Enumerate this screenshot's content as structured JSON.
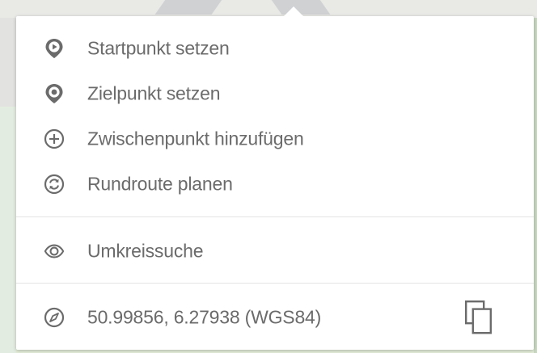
{
  "menu": {
    "items": [
      {
        "label": "Startpunkt setzen",
        "icon": "start-pin-icon"
      },
      {
        "label": "Zielpunkt setzen",
        "icon": "destination-pin-icon"
      },
      {
        "label": "Zwischenpunkt hinzufügen",
        "icon": "plus-circle-icon"
      },
      {
        "label": "Rundroute planen",
        "icon": "roundtrip-icon"
      }
    ],
    "search": {
      "label": "Umkreissuche",
      "icon": "eye-icon"
    },
    "coordinates": {
      "label": "50.99856, 6.27938 (WGS84)",
      "icon": "compass-icon",
      "copy_icon": "copy-icon"
    }
  },
  "colors": {
    "icon": "#6b6b6b",
    "text": "#6b6b6b",
    "divider": "#e3e3e3",
    "background": "#ffffff"
  }
}
